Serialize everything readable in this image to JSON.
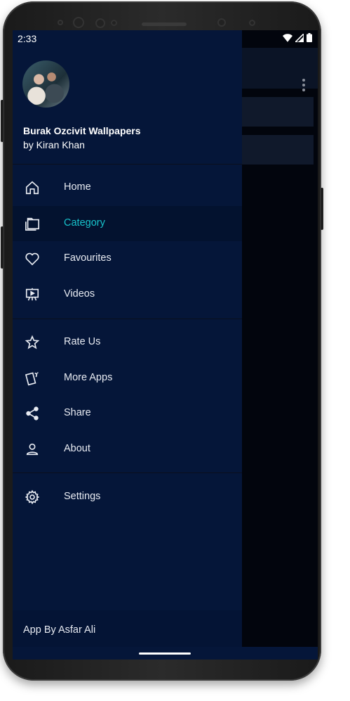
{
  "status_bar": {
    "time": "2:33",
    "icons": [
      "wifi-icon",
      "signal-icon",
      "battery-icon"
    ]
  },
  "drawer": {
    "header": {
      "title": "Burak Ozcivit Wallpapers",
      "subtitle": "by Kiran Khan"
    },
    "sections": [
      [
        {
          "label": "Home",
          "icon": "home-icon",
          "active": false
        },
        {
          "label": "Category",
          "icon": "category-icon",
          "active": true
        },
        {
          "label": "Favourites",
          "icon": "heart-icon",
          "active": false
        },
        {
          "label": "Videos",
          "icon": "videos-icon",
          "active": false
        }
      ],
      [
        {
          "label": "Rate Us",
          "icon": "star-icon",
          "active": false
        },
        {
          "label": "More Apps",
          "icon": "more-apps-icon",
          "active": false
        },
        {
          "label": "Share",
          "icon": "share-icon",
          "active": false
        },
        {
          "label": "About",
          "icon": "person-icon",
          "active": false
        }
      ],
      [
        {
          "label": "Settings",
          "icon": "gear-icon",
          "active": false
        }
      ]
    ],
    "footer": "App By Asfar Ali"
  },
  "colors": {
    "drawer_bg": "#051639",
    "active_item_bg": "#03122f",
    "active_accent": "#17c3cc",
    "text": "#e8ebf2",
    "scrim": "#02050d"
  }
}
